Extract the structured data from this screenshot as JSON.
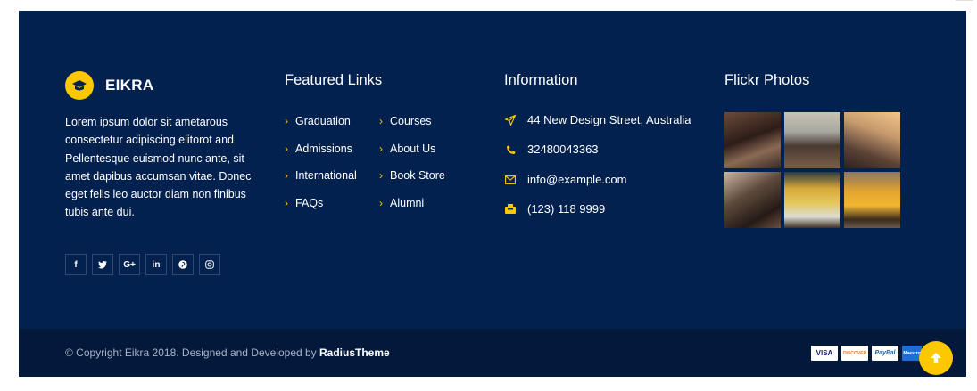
{
  "brand": {
    "name": "EIKRA",
    "icon": "graduation-cap-icon"
  },
  "about_text": "Lorem ipsum dolor sit ametarous consectetur adipiscing elitorot and Pellentesque euismod nunc ante, sit amet dapibus accumsan vitae. Donec eget felis leo auctor diam non finibus tubis ante dui.",
  "socials": [
    {
      "name": "facebook-icon",
      "glyph": "f"
    },
    {
      "name": "twitter-icon",
      "glyph": "🐦"
    },
    {
      "name": "google-plus-icon",
      "glyph": "G+"
    },
    {
      "name": "linkedin-icon",
      "glyph": "in"
    },
    {
      "name": "pinterest-icon",
      "glyph": "℗"
    },
    {
      "name": "instagram-icon",
      "glyph": "◎"
    }
  ],
  "featured_links": {
    "title": "Featured Links",
    "col1": [
      "Graduation",
      "Admissions",
      "International",
      "FAQs"
    ],
    "col2": [
      "Courses",
      "About Us",
      "Book Store",
      "Alumni"
    ]
  },
  "information": {
    "title": "Information",
    "address": "44 New Design Street, Australia",
    "phone": "32480043363",
    "email": "info@example.com",
    "fax": "(123) 118 9999"
  },
  "flickr": {
    "title": "Flickr Photos"
  },
  "footer_bottom": {
    "copyright": "© Copyright Eikra 2018. Designed and Developed by ",
    "developer": "RadiusTheme"
  },
  "payments": [
    "VISA",
    "DISCOVER",
    "PayPal",
    "Maestro"
  ],
  "colors": {
    "background": "#03214e",
    "bottom_bar": "#02193c",
    "accent": "#fdc800"
  }
}
